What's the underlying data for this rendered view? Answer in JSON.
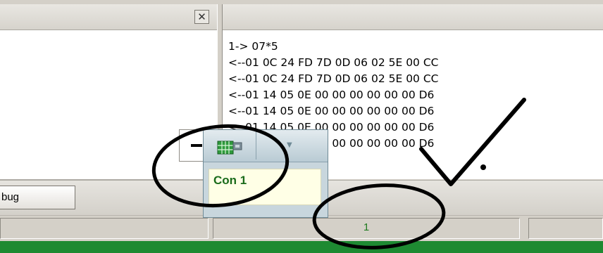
{
  "left_pane": {
    "close_glyph": "✕"
  },
  "console": {
    "lines": [
      "1-> 07*5",
      "<--01 0C 24 FD 7D 0D 06 02 5E 00 CC",
      "<--01 0C 24 FD 7D 0D 06 02 5E 00 CC",
      "<--01 14 05 0E 00 00 00 00 00 00 D6",
      "<--01 14 05 0E 00 00 00 00 00 00 D6",
      "<--01 14 05 0E 00 00 00 00 00 00 D6",
      "<--01 14 05 0E 00 00 00 00 00 00 D6"
    ]
  },
  "toolbar": {
    "debug_label": "bug"
  },
  "status_bar": {
    "connection_count": "1"
  },
  "popup": {
    "connection_label": "Con 1",
    "icon": "network-grid-icon",
    "caret": "▼"
  },
  "colors": {
    "status_green": "#1e8a32",
    "label_green": "#1a6b1a",
    "ink": "#000000"
  }
}
